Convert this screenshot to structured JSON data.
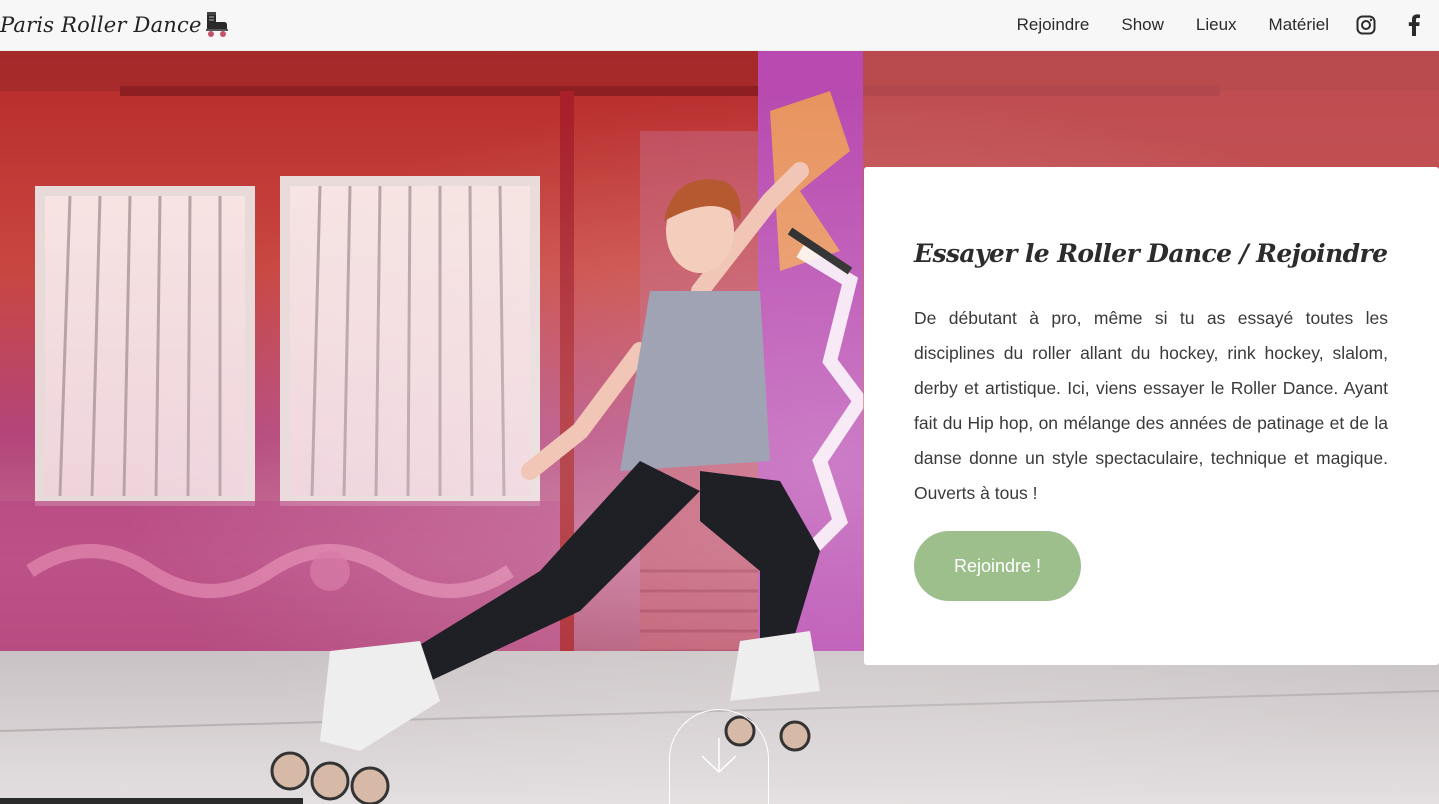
{
  "nav": {
    "brand": "Paris Roller Dance",
    "brand_icon": "roller-skate-icon",
    "links": [
      "Rejoindre",
      "Show",
      "Lieux",
      "Matériel"
    ],
    "social": [
      "instagram-icon",
      "facebook-icon"
    ]
  },
  "hero": {
    "image": "roller-dancer-photo"
  },
  "card": {
    "title": "Essayer le Roller Dance / Rejoindre",
    "body": "De débutant à pro, même si tu as essayé toutes les disciplines du roller allant du hockey, rink hockey, slalom, derby et artistique. Ici, viens essayer le Roller Dance. Ayant fait du Hip hop, on mélange des années de patinage et de la danse donne un style spectaculaire, technique et magique. Ouverts à tous !",
    "button": "Rejoindre !"
  },
  "scroll": {
    "icon": "arrow-down-icon"
  },
  "colors": {
    "button": "#9dbf8c",
    "nav_bg": "#f7f7f7",
    "card_bg": "#ffffff",
    "text": "#3a3a3a"
  }
}
